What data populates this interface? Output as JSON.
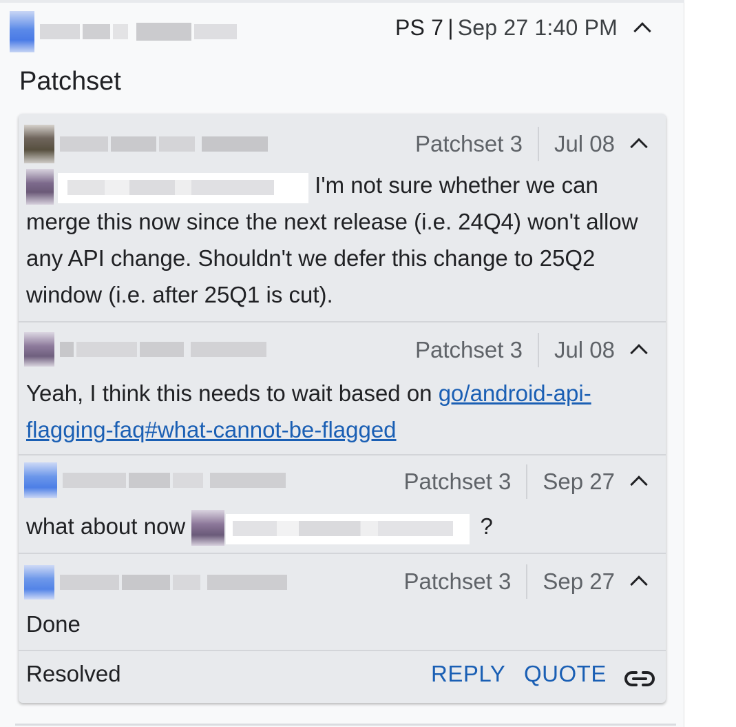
{
  "header": {
    "patchset_label": "PS 7",
    "separator": "|",
    "timestamp": "Sep 27 1:40 PM",
    "collapse_icon": "chevron-up-icon"
  },
  "section": {
    "title": "Patchset"
  },
  "thread": {
    "comments": [
      {
        "patchset": "Patchset 3",
        "date": "Jul 08",
        "text": "I'm not sure whether we can merge this now since the next release (i.e. 24Q4) won't allow any API change. Shouldn't we defer this change to 25Q2 window (i.e. after 25Q1 is cut)."
      },
      {
        "patchset": "Patchset 3",
        "date": "Jul 08",
        "text_prefix": "Yeah, I think this needs to wait based on ",
        "link_text": "go/android-api-flagging-faq#what-cannot-be-flagged"
      },
      {
        "patchset": "Patchset 3",
        "date": "Sep 27",
        "text_prefix": "what about now",
        "text_suffix": "?"
      },
      {
        "patchset": "Patchset 3",
        "date": "Sep 27",
        "text": "Done"
      }
    ],
    "footer": {
      "status": "Resolved",
      "reply_label": "REPLY",
      "quote_label": "QUOTE",
      "link_icon": "link-icon"
    }
  },
  "colors": {
    "link": "#1a5fb4",
    "thread_bg": "#e8eaed",
    "meta_text": "#5f6368"
  }
}
